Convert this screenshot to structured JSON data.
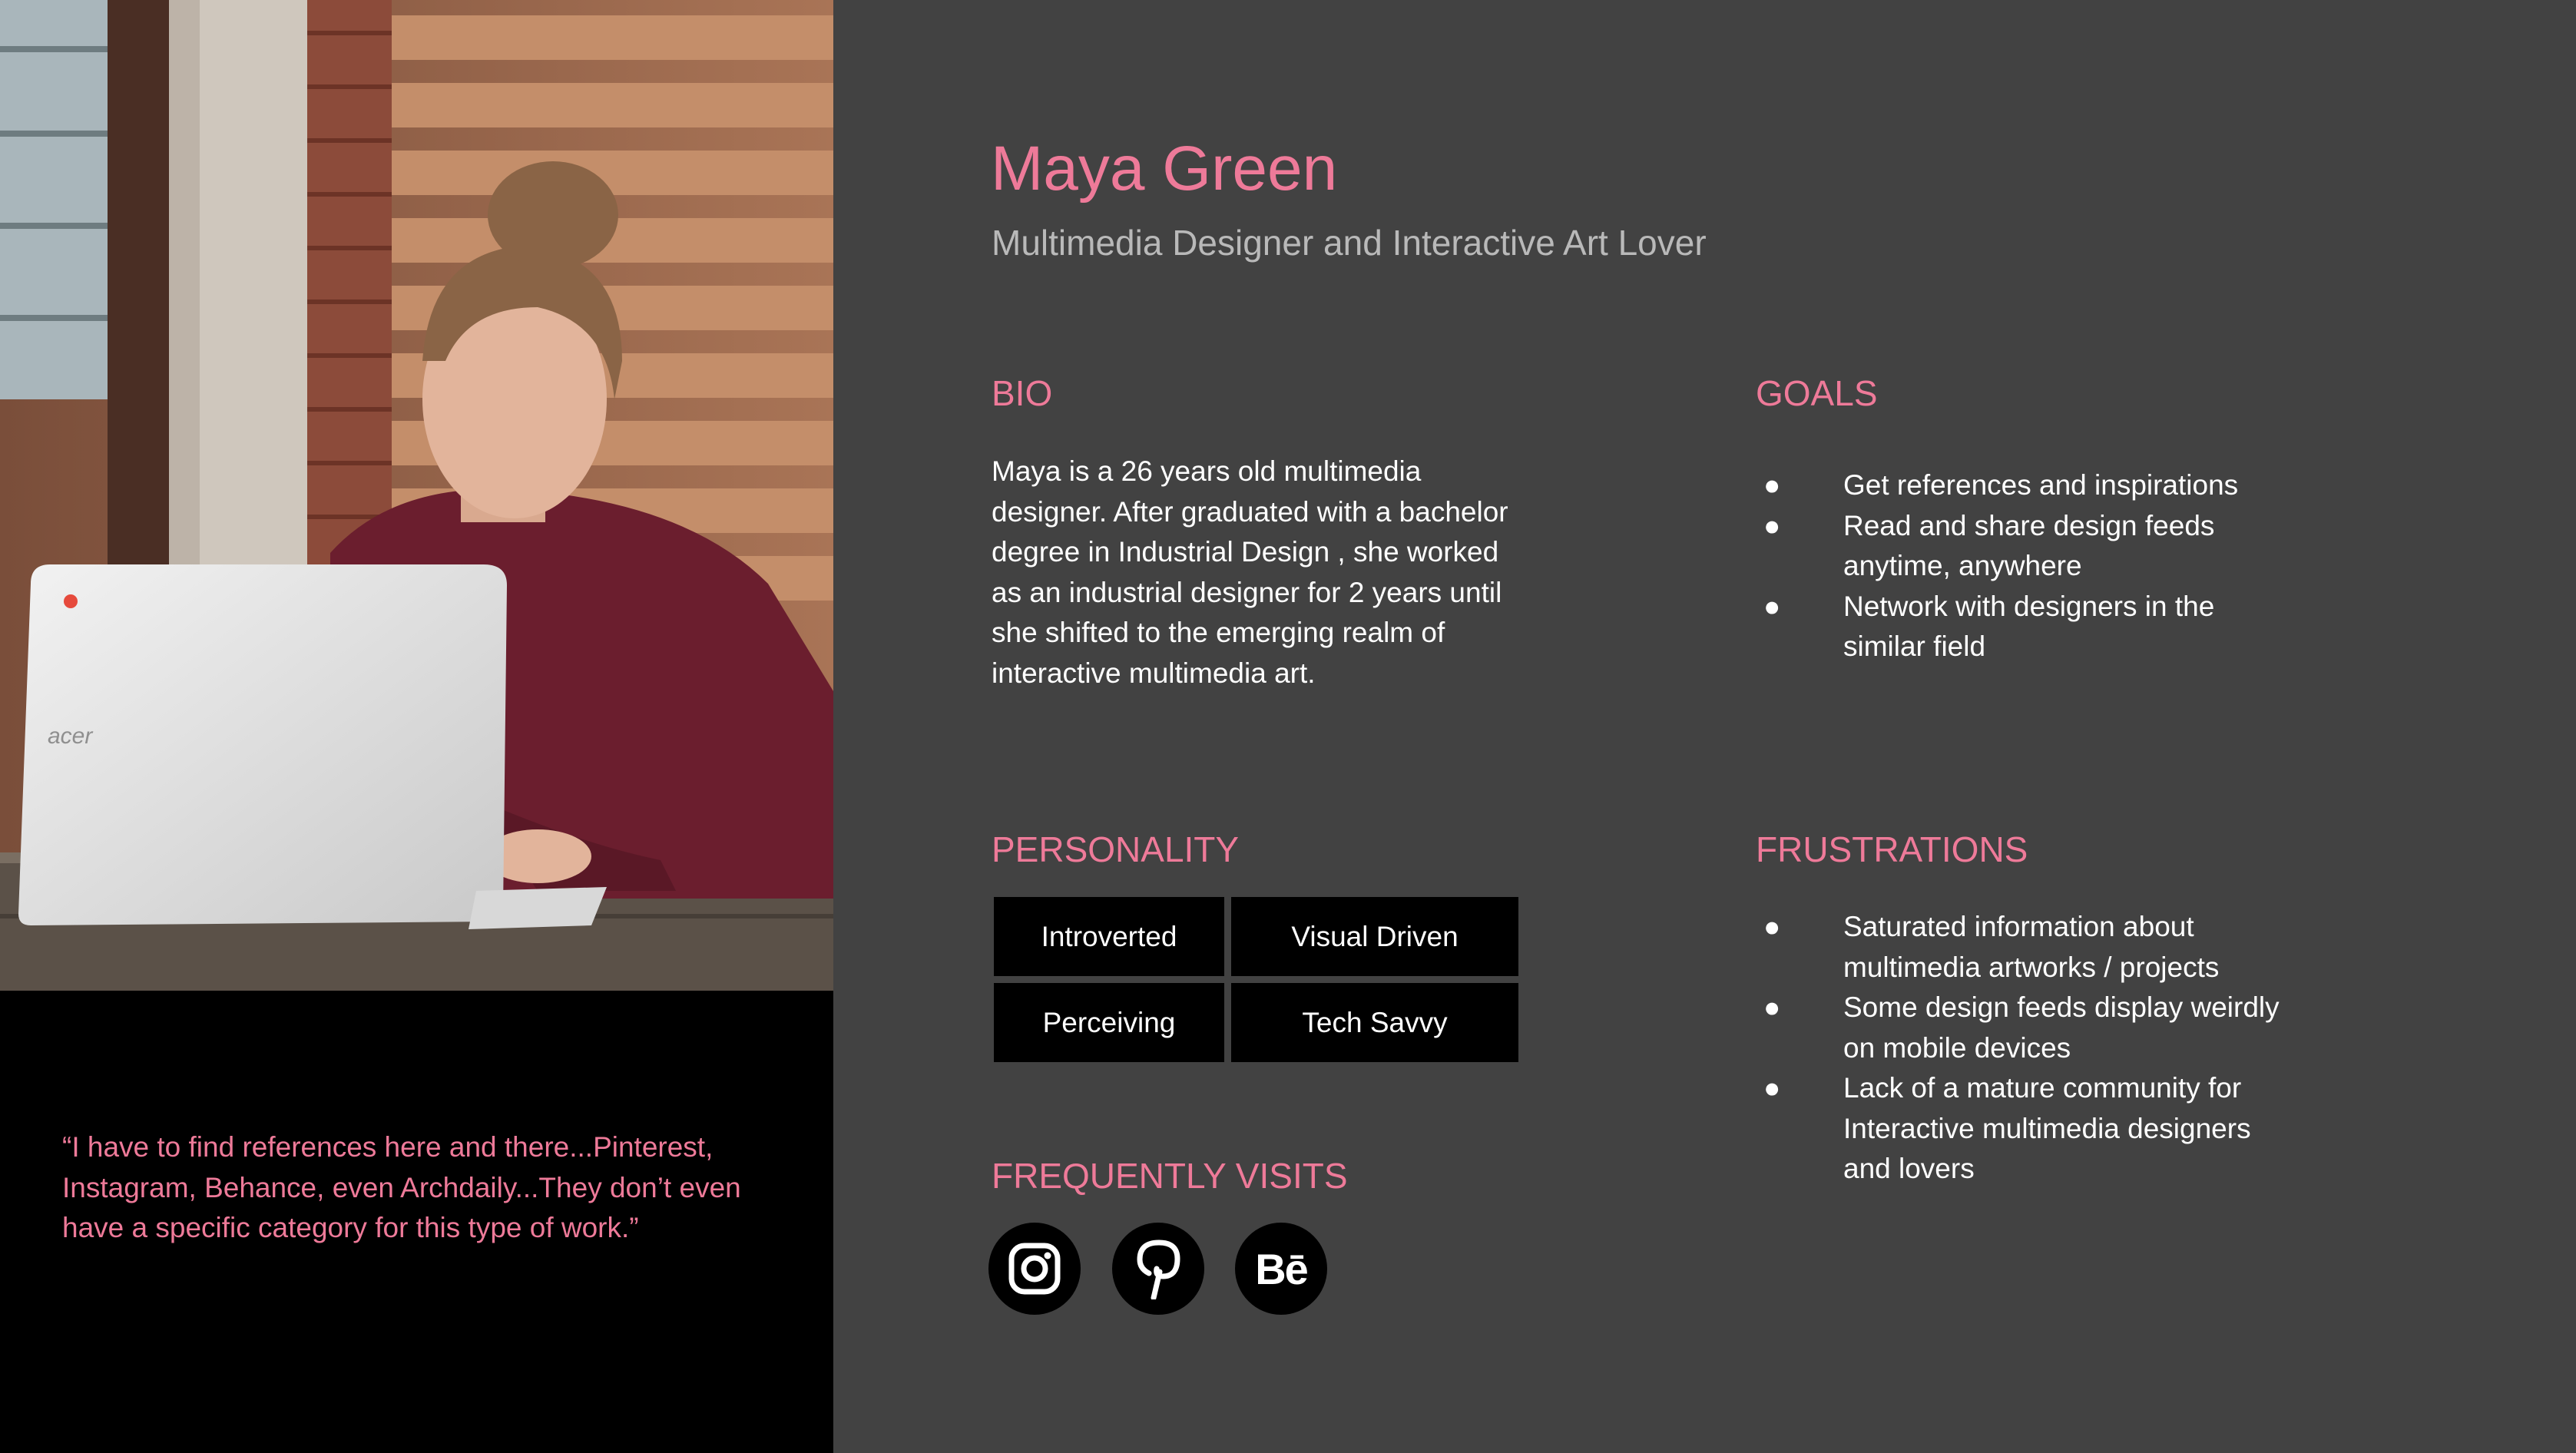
{
  "persona": {
    "name": "Maya Green",
    "subtitle": "Multimedia Designer and Interactive Art Lover",
    "photo_icon": "persona-photo",
    "quote": "“I have to find references here and there...Pinterest, Instagram, Behance, even Archdaily...They don’t even have a specific category for this type of work.”"
  },
  "bio": {
    "title": "BIO",
    "text": "Maya is a 26 years old multimedia designer. After graduated with a bachelor degree in Industrial Design , she worked as an industrial designer for 2 years until she shifted to the emerging realm of interactive multimedia art."
  },
  "goals": {
    "title": "GOALS",
    "items": [
      "Get references and inspirations",
      "Read and share design feeds anytime, anywhere",
      "Network with designers in the similar field"
    ]
  },
  "personality": {
    "title": "PERSONALITY",
    "tags": [
      "Introverted",
      "Visual Driven",
      "Perceiving",
      "Tech Savvy"
    ]
  },
  "frustrations": {
    "title": "FRUSTRATIONS",
    "items": [
      "Saturated information about multimedia artworks / projects",
      "Some design feeds display weirdly on mobile devices",
      "Lack of a mature community for Interactive multimedia designers and lovers"
    ]
  },
  "visits": {
    "title": "FREQUENTLY VISITS",
    "sites": [
      {
        "name": "Instagram",
        "icon": "instagram-icon"
      },
      {
        "name": "Pinterest",
        "icon": "pinterest-icon"
      },
      {
        "name": "Behance",
        "icon": "behance-icon",
        "glyph": "Bē"
      }
    ]
  },
  "bullet_glyph": "●",
  "laptop_brand": "acer",
  "colors": {
    "accent": "#ee7a99",
    "panel_bg": "#424242",
    "left_bg": "#000000",
    "subtitle": "#b9b9b9",
    "text": "#ffffff",
    "tag_bg": "#000000"
  }
}
